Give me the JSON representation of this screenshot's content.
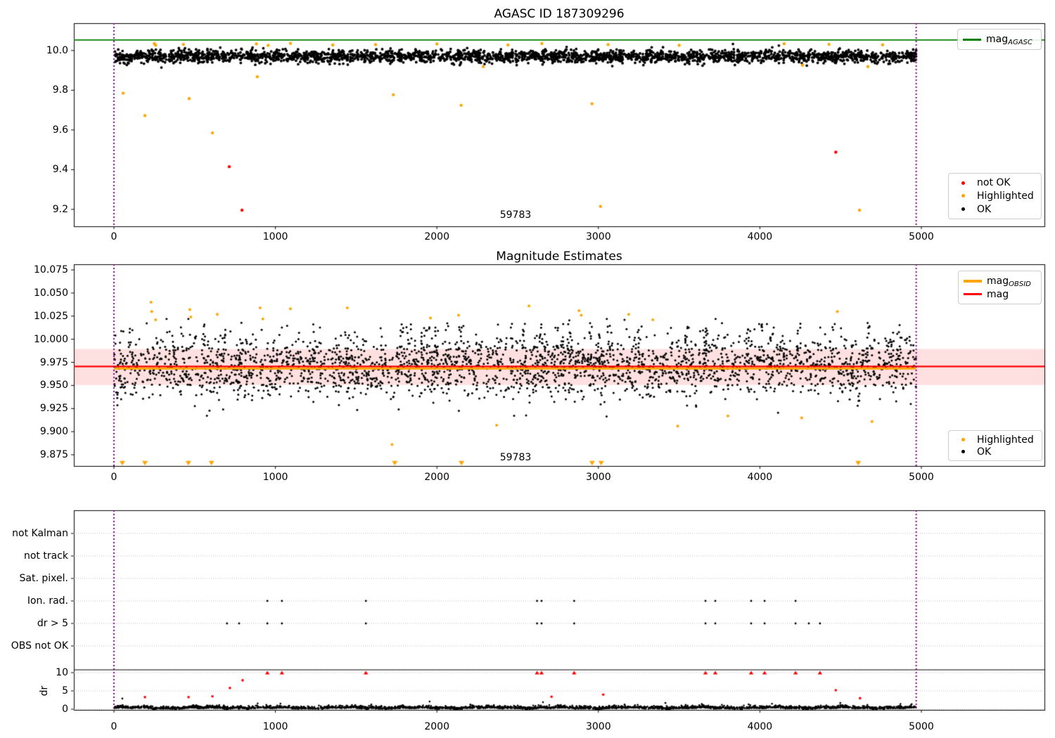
{
  "colors": {
    "ok": "#000000",
    "highlighted": "#ffa500",
    "not_ok": "#ff0000",
    "mag_agasc_line": "#008000",
    "mag_line": "#ff0000",
    "mag_obsid_line": "#ffa500",
    "band_fill": "rgba(255,0,0,0.12)",
    "obs_boundary": "#800080",
    "grid": "#bbbbbb",
    "spine": "#000000"
  },
  "chart_data": [
    {
      "id": "top",
      "type": "scatter",
      "title": "AGASC ID 187309296",
      "obsid_label": "59783",
      "x_axis": {
        "range": [
          -248,
          5762
        ],
        "ticks": [
          {
            "v": 0,
            "label": "0"
          },
          {
            "v": 1000,
            "label": "1000"
          },
          {
            "v": 2000,
            "label": "2000"
          },
          {
            "v": 3000,
            "label": "3000"
          },
          {
            "v": 4000,
            "label": "4000"
          },
          {
            "v": 5000,
            "label": "5000"
          }
        ]
      },
      "y_axis": {
        "range": [
          9.115,
          10.138
        ],
        "ticks": [
          {
            "v": 10.0,
            "label": "10.0"
          },
          {
            "v": 9.8,
            "label": "9.8"
          },
          {
            "v": 9.6,
            "label": "9.6"
          },
          {
            "v": 9.4,
            "label": "9.4"
          },
          {
            "v": 9.2,
            "label": "9.2"
          }
        ]
      },
      "guide": {
        "mag_agasc": 10.053,
        "obs_bounds": [
          0,
          4968
        ]
      },
      "legend_line": {
        "main": "mag",
        "sub": "AGASC"
      },
      "legend_points": [
        {
          "label": "not OK",
          "color_key": "not_ok"
        },
        {
          "label": "Highlighted",
          "color_key": "highlighted"
        },
        {
          "label": "OK",
          "color_key": "ok"
        }
      ],
      "series": {
        "ok_band": {
          "n": 2600,
          "x_range": [
            0,
            4968
          ],
          "mean": 9.9705,
          "std": 0.016,
          "clip": [
            9.914,
            10.042
          ],
          "seed": 42
        },
        "highlighted": [
          [
            57,
            9.785
          ],
          [
            192,
            9.672
          ],
          [
            466,
            9.758
          ],
          [
            610,
            9.585
          ],
          [
            888,
            9.868
          ],
          [
            1730,
            9.777
          ],
          [
            2150,
            9.724
          ],
          [
            2287,
            9.919
          ],
          [
            2960,
            9.732
          ],
          [
            3013,
            9.215
          ],
          [
            4264,
            9.926
          ],
          [
            4617,
            9.196
          ],
          [
            4669,
            9.919
          ],
          [
            250,
            10.035
          ],
          [
            258,
            10.027
          ],
          [
            430,
            10.031
          ],
          [
            882,
            10.033
          ],
          [
            955,
            10.026
          ],
          [
            1093,
            10.036
          ],
          [
            1355,
            10.028
          ],
          [
            1620,
            10.03
          ],
          [
            2000,
            10.033
          ],
          [
            2440,
            10.028
          ],
          [
            2650,
            10.035
          ],
          [
            3060,
            10.03
          ],
          [
            3500,
            10.026
          ],
          [
            4150,
            10.034
          ],
          [
            4428,
            10.031
          ],
          [
            4760,
            10.029
          ]
        ],
        "not_ok": [
          [
            714,
            9.415
          ],
          [
            793,
            9.196
          ],
          [
            4470,
            9.488
          ]
        ]
      }
    },
    {
      "id": "middle",
      "type": "scatter",
      "title": "Magnitude Estimates",
      "obsid_label": "59783",
      "x_axis": {
        "range": [
          -248,
          5762
        ],
        "ticks": [
          {
            "v": 0,
            "label": "0"
          },
          {
            "v": 1000,
            "label": "1000"
          },
          {
            "v": 2000,
            "label": "2000"
          },
          {
            "v": 3000,
            "label": "3000"
          },
          {
            "v": 4000,
            "label": "4000"
          },
          {
            "v": 5000,
            "label": "5000"
          }
        ]
      },
      "y_axis": {
        "range": [
          9.863,
          10.081
        ],
        "ticks": [
          {
            "v": 10.075,
            "label": "10.075"
          },
          {
            "v": 10.05,
            "label": "10.050"
          },
          {
            "v": 10.025,
            "label": "10.025"
          },
          {
            "v": 10.0,
            "label": "10.000"
          },
          {
            "v": 9.975,
            "label": "9.975"
          },
          {
            "v": 9.95,
            "label": "9.950"
          },
          {
            "v": 9.925,
            "label": "9.925"
          },
          {
            "v": 9.9,
            "label": "9.900"
          },
          {
            "v": 9.875,
            "label": "9.875"
          }
        ]
      },
      "guide": {
        "mag": 9.9705,
        "mag_obsid": 9.9695,
        "band": [
          9.9505,
          9.9895
        ],
        "obs_bounds": [
          0,
          4968
        ]
      },
      "legend_lines": [
        {
          "main": "mag",
          "sub": "OBSID",
          "color_key": "mag_obsid_line"
        },
        {
          "main": "mag",
          "sub": "",
          "color_key": "mag_line"
        }
      ],
      "legend_points": [
        {
          "label": "Highlighted",
          "color_key": "highlighted"
        },
        {
          "label": "OK",
          "color_key": "ok"
        }
      ],
      "series": {
        "ok_band": {
          "n": 2600,
          "x_range": [
            0,
            4968
          ],
          "mean": 9.97,
          "std": 0.0165,
          "clip": [
            9.909,
            10.022
          ],
          "seed": 7
        },
        "streaks": {
          "n": 40,
          "seed": 13
        },
        "highlighted_high": [
          [
            230,
            10.04
          ],
          [
            234,
            10.03
          ],
          [
            258,
            10.021
          ],
          [
            470,
            10.032
          ],
          [
            476,
            10.024
          ],
          [
            640,
            10.027
          ],
          [
            905,
            10.034
          ],
          [
            922,
            10.022
          ],
          [
            1093,
            10.033
          ],
          [
            1445,
            10.034
          ],
          [
            1960,
            10.023
          ],
          [
            2134,
            10.026
          ],
          [
            2570,
            10.036
          ],
          [
            2880,
            10.031
          ],
          [
            2894,
            10.026
          ],
          [
            3188,
            10.027
          ],
          [
            3337,
            10.021
          ],
          [
            4480,
            10.03
          ]
        ],
        "highlighted_low": [
          [
            1722,
            9.886
          ],
          [
            2370,
            9.907
          ],
          [
            3491,
            9.906
          ],
          [
            3802,
            9.917
          ],
          [
            4259,
            9.915
          ],
          [
            4694,
            9.911
          ]
        ],
        "clipped_low_x": [
          52,
          192,
          461,
          604,
          1739,
          2152,
          2961,
          3017,
          4609
        ]
      }
    },
    {
      "id": "bottom",
      "type": "scatter",
      "obsid_label": "",
      "x_axis": {
        "range": [
          -248,
          5762
        ],
        "ticks": [
          {
            "v": 0,
            "label": "0"
          },
          {
            "v": 1000,
            "label": "1000"
          },
          {
            "v": 2000,
            "label": "2000"
          },
          {
            "v": 3000,
            "label": "3000"
          },
          {
            "v": 4000,
            "label": "4000"
          },
          {
            "v": 5000,
            "label": "5000"
          }
        ]
      },
      "y_axis": {
        "flags": [
          {
            "label": "not Kalman"
          },
          {
            "label": "not track"
          },
          {
            "label": "Sat. pixel."
          },
          {
            "label": "Ion. rad."
          },
          {
            "label": "dr > 5"
          },
          {
            "label": "OBS not OK"
          }
        ],
        "dr_ticks": [
          {
            "v": 10,
            "label": "10"
          },
          {
            "v": 5,
            "label": "5"
          },
          {
            "v": 0,
            "label": "0"
          }
        ],
        "dr_label": "dr"
      },
      "guide": {
        "obs_bounds": [
          0,
          4968
        ],
        "dr_clip": 10
      },
      "series": {
        "ion_rad_x": [
          950,
          1040,
          1560,
          2620,
          2648,
          2850,
          3663,
          3724,
          3946,
          4029,
          4221
        ],
        "dr_gt5_x": [
          700,
          775,
          950,
          1040,
          1560,
          2620,
          2648,
          2850,
          3663,
          3724,
          3946,
          4029,
          4221,
          4303,
          4372
        ],
        "dr_band": {
          "n": 2600,
          "x_range": [
            0,
            4968
          ],
          "seed": 99
        },
        "dr_red": [
          [
            192,
            3.3
          ],
          [
            462,
            3.3
          ],
          [
            610,
            3.5
          ],
          [
            718,
            5.8
          ],
          [
            797,
            7.9
          ],
          [
            2710,
            3.4
          ],
          [
            3030,
            4.0
          ],
          [
            4470,
            5.2
          ],
          [
            4620,
            3.0
          ]
        ],
        "dr_red_clipped_x": [
          950,
          1040,
          1560,
          2620,
          2648,
          2850,
          3663,
          3724,
          3946,
          4029,
          4221,
          4372
        ],
        "dr_black": [
          [
            52,
            2.9
          ],
          [
            890,
            1.6
          ],
          [
            1594,
            1.3
          ],
          [
            1955,
            2.1
          ],
          [
            2657,
            1.9
          ],
          [
            3415,
            1.7
          ],
          [
            4075,
            1.5
          ]
        ]
      }
    }
  ]
}
